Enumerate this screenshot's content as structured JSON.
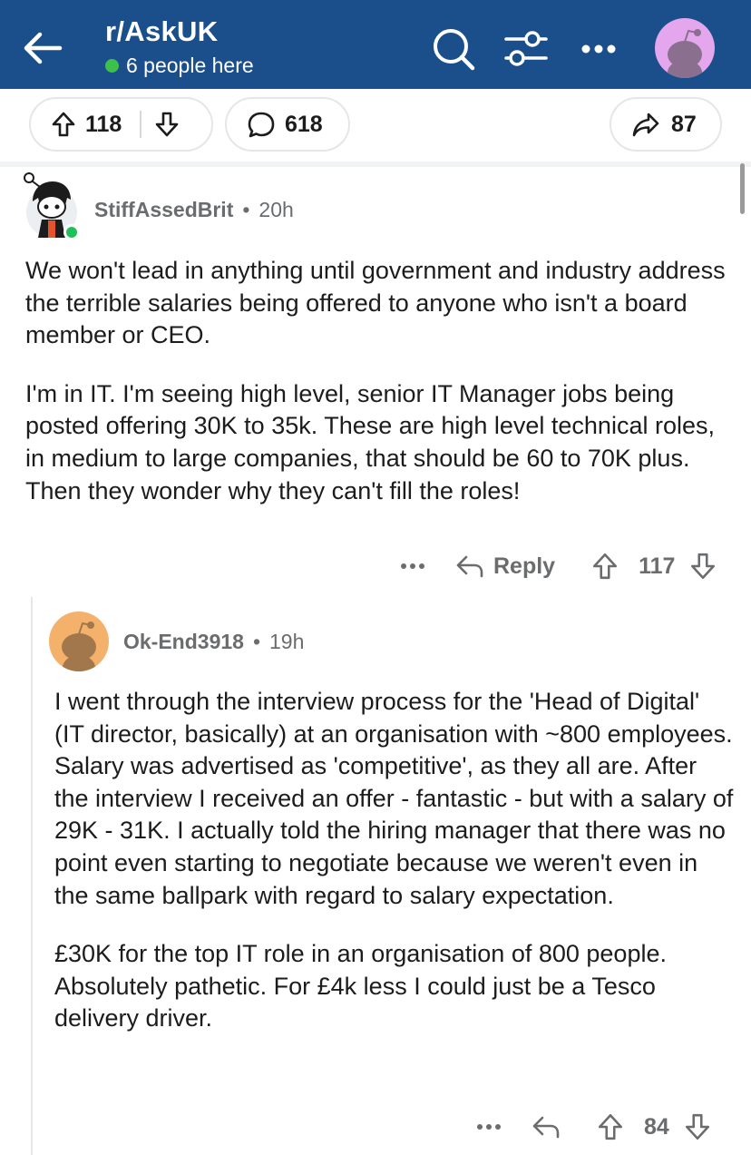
{
  "header": {
    "subreddit": "r/AskUK",
    "online_text": "6 people here"
  },
  "post_actions": {
    "upvotes": "118",
    "comments": "618",
    "shares": "87"
  },
  "comments": [
    {
      "username": "StiffAssedBrit",
      "age": "20h",
      "paragraphs": [
        "We won't lead in anything until government and industry address the terrible salaries being offered to anyone who isn't a board member or CEO.",
        "I'm in IT.  I'm seeing high level, senior IT Manager jobs being posted offering 30K to 35k. These are high level technical roles, in medium to large companies, that should be 60 to 70K plus. Then they wonder why they can't fill the roles!"
      ],
      "reply_label": "Reply",
      "score": "117"
    },
    {
      "username": "Ok-End3918",
      "age": "19h",
      "paragraphs": [
        "I went through the interview process for the 'Head of Digital' (IT director, basically) at an organisation with ~800 employees. Salary was advertised as 'competitive', as they all are. After the interview I received an offer - fantastic - but with a salary of 29K - 31K. I actually told the hiring manager that there was no point even starting to negotiate because we weren't even in the same ballpark with regard to salary expectation.",
        "£30K for the top IT role in an organisation of 800 people. Absolutely pathetic. For £4k less I could just be a Tesco delivery driver."
      ],
      "score": "84"
    }
  ],
  "icons": {
    "back": "back-arrow-icon",
    "search": "search-icon",
    "filter": "filter-icon",
    "more": "more-icon",
    "upvote": "upvote-icon",
    "downvote": "downvote-icon",
    "comment": "comment-bubble-icon",
    "share": "share-icon",
    "reply": "reply-icon"
  },
  "colors": {
    "header_bg": "#1a4f8b",
    "online_dot": "#3ec14a",
    "avatar_purple": "#e4a7ee",
    "avatar_orange": "#f3b16c"
  }
}
